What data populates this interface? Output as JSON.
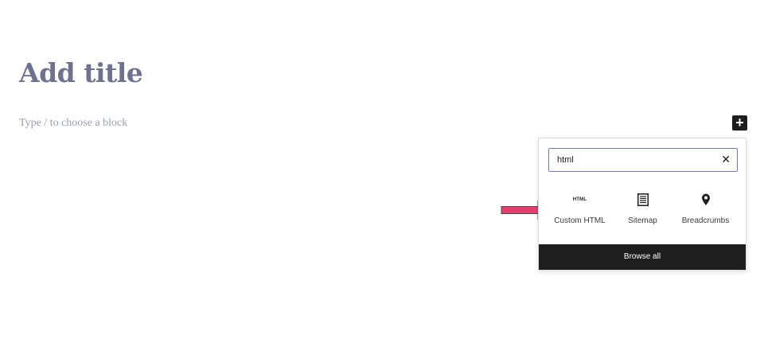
{
  "editor": {
    "title_placeholder": "Add title",
    "block_placeholder": "Type / to choose a block"
  },
  "inserter": {
    "toggle_symbol": "+",
    "toggle_icon": "plus-icon",
    "search": {
      "value": "html",
      "clear_symbol": "✕"
    },
    "results": [
      {
        "label": "Custom HTML",
        "icon": "html-icon",
        "icon_text": "HTML"
      },
      {
        "label": "Sitemap",
        "icon": "sitemap-icon"
      },
      {
        "label": "Breadcrumbs",
        "icon": "map-pin-icon"
      }
    ],
    "browse_all_label": "Browse all"
  },
  "annotation": {
    "arrow_color": "#e23f6e"
  }
}
